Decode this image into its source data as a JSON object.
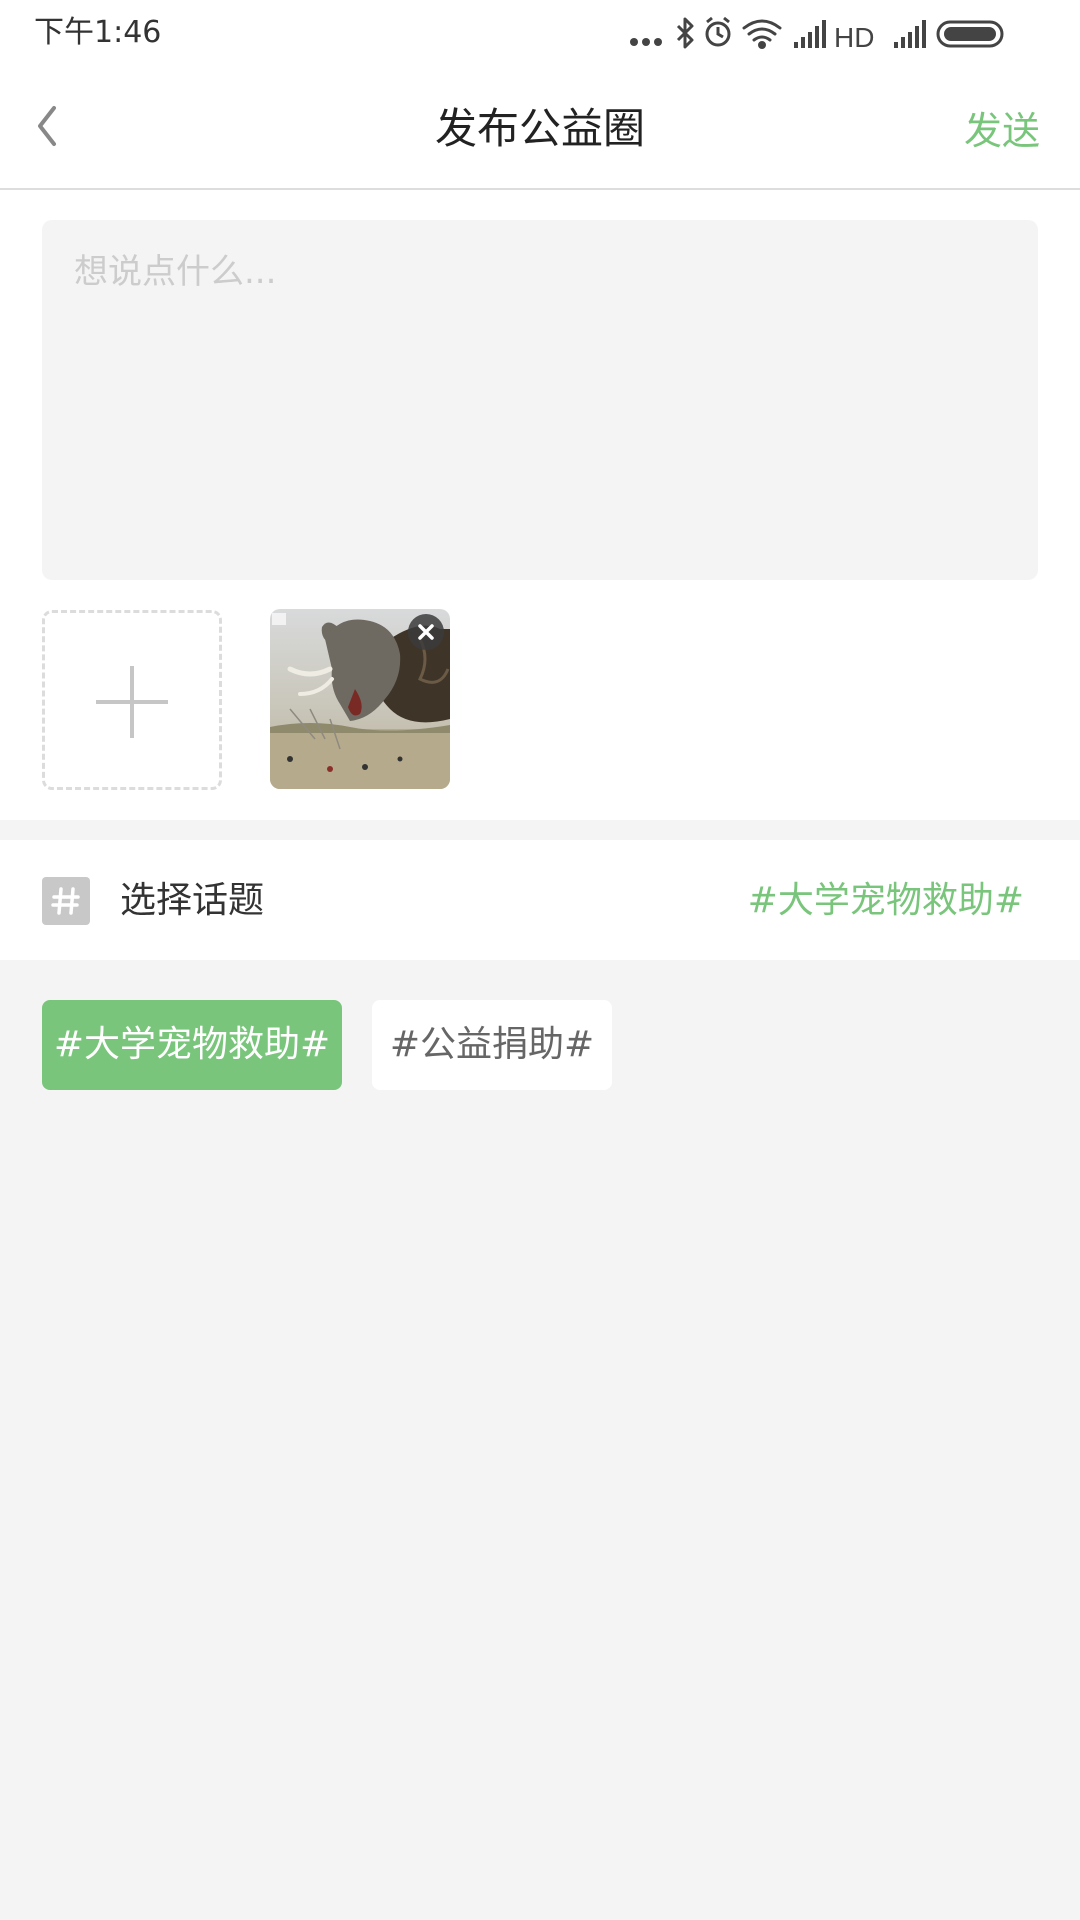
{
  "status_bar": {
    "time": "下午1:46",
    "network_label": "HD",
    "icons": [
      "more-dots-icon",
      "bluetooth-icon",
      "alarm-icon",
      "wifi-icon",
      "signal-icon",
      "signal-icon",
      "battery-icon"
    ]
  },
  "header": {
    "title": "发布公益圈",
    "send_label": "发送",
    "back_icon": "chevron-left-icon"
  },
  "compose": {
    "placeholder": "想说点什么...",
    "value": "",
    "add_icon": "plus-icon",
    "photos": [
      {
        "alt": "elephant",
        "remove_icon": "close-icon"
      }
    ]
  },
  "topic": {
    "icon": "hash-icon",
    "label": "选择话题",
    "selected": "#大学宠物救助#",
    "options": [
      {
        "label": "#大学宠物救助#",
        "active": true
      },
      {
        "label": "#公益捐助#",
        "active": false
      }
    ]
  },
  "colors": {
    "accent": "#79c57b",
    "background": "#f4f4f4"
  }
}
